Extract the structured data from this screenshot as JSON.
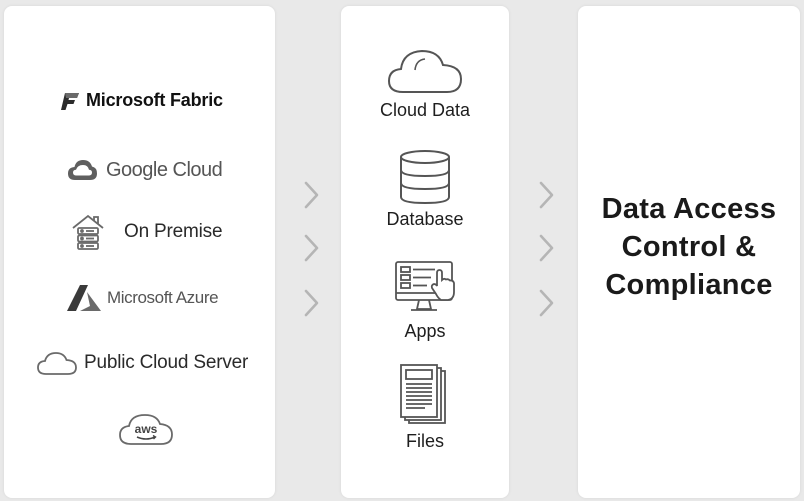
{
  "sources": {
    "microsoft_fabric": "Microsoft Fabric",
    "google_cloud": "Google Cloud",
    "on_premise": "On Premise",
    "microsoft_azure": "Microsoft Azure",
    "public_cloud_server": "Public Cloud Server",
    "aws_logo_text": "aws"
  },
  "data_types": {
    "cloud_data": "Cloud Data",
    "database": "Database",
    "apps": "Apps",
    "files": "Files"
  },
  "target": {
    "line1": "Data Access",
    "line2": "Control &",
    "line3": "Compliance"
  },
  "icons": [
    "microsoft-fabric-icon",
    "google-cloud-icon",
    "on-premise-server-icon",
    "microsoft-azure-icon",
    "public-cloud-icon",
    "aws-cloud-icon",
    "cloud-icon",
    "database-icon",
    "apps-monitor-icon",
    "files-icon",
    "chevron-right-icon"
  ],
  "colors": {
    "background": "#e9e9e9",
    "panel": "#ffffff",
    "icon_stroke": "#555555",
    "chevron": "#b5b5b5"
  }
}
